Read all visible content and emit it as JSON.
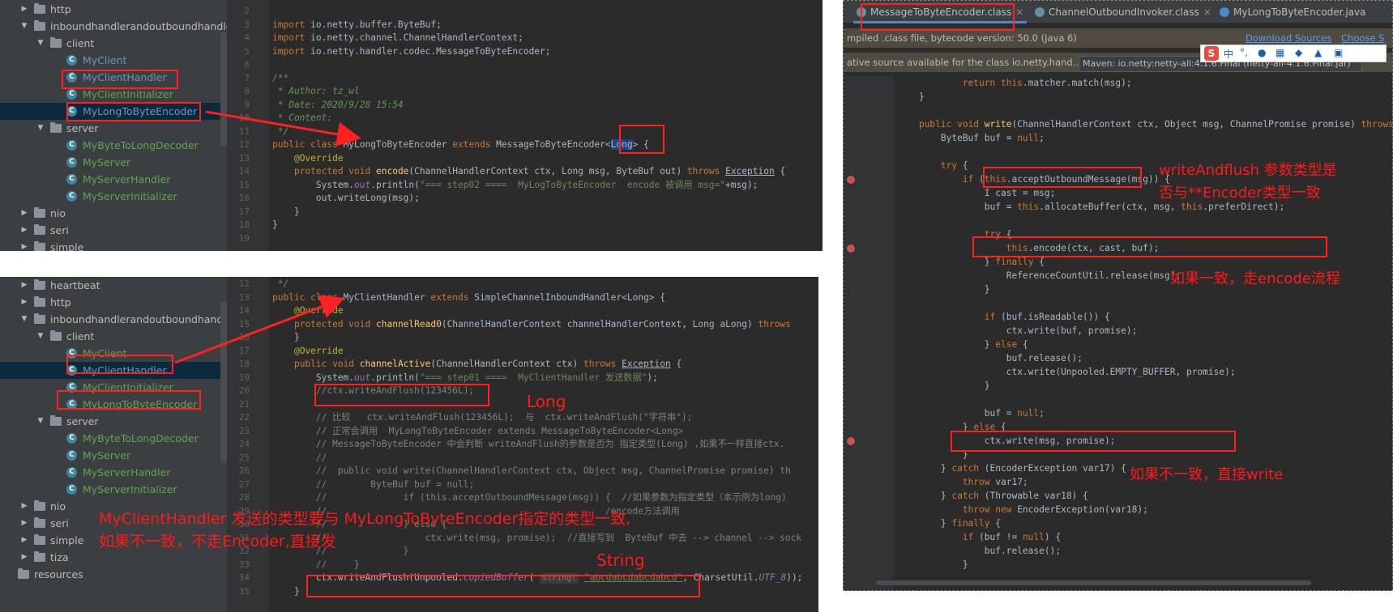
{
  "top_left": {
    "tree": [
      {
        "label": "http",
        "indent": 0,
        "type": "folder",
        "arrow": "▶"
      },
      {
        "label": "inboundhandlerandoutboundhandler",
        "indent": 0,
        "type": "folder",
        "arrow": "▼"
      },
      {
        "label": "client",
        "indent": 1,
        "type": "folder",
        "arrow": "▼"
      },
      {
        "label": "MyClient",
        "indent": 2,
        "type": "class",
        "color": "b"
      },
      {
        "label": "MyClientHandler",
        "indent": 2,
        "type": "class",
        "color": "b"
      },
      {
        "label": "MyClientInitializer",
        "indent": 2,
        "type": "class",
        "color": "g"
      },
      {
        "label": "MyLongToByteEncoder",
        "indent": 2,
        "type": "class",
        "color": "b",
        "selected": true
      },
      {
        "label": "server",
        "indent": 1,
        "type": "folder",
        "arrow": "▼"
      },
      {
        "label": "MyByteToLongDecoder",
        "indent": 2,
        "type": "class",
        "color": "g"
      },
      {
        "label": "MyServer",
        "indent": 2,
        "type": "class",
        "color": "g"
      },
      {
        "label": "MyServerHandler",
        "indent": 2,
        "type": "class",
        "color": "g"
      },
      {
        "label": "MyServerInitializer",
        "indent": 2,
        "type": "class",
        "color": "g"
      },
      {
        "label": "nio",
        "indent": 0,
        "type": "folder",
        "arrow": "▶"
      },
      {
        "label": "seri",
        "indent": 0,
        "type": "folder",
        "arrow": "▶"
      },
      {
        "label": "simple",
        "indent": 0,
        "type": "folder",
        "arrow": "▶"
      }
    ],
    "line_numbers": [
      "2",
      "3",
      "4",
      "5",
      "6",
      "7",
      "8",
      "9",
      "10",
      "11",
      "12",
      "13",
      "14",
      "15",
      "16",
      "17",
      "18",
      "19"
    ],
    "code": [
      "",
      "<span class='kw'>import</span> io.netty.buffer.ByteBuf;",
      "<span class='kw'>import</span> io.netty.channel.ChannelHandlerContext;",
      "<span class='kw'>import</span> io.netty.handler.codec.MessageToByteEncoder;",
      "",
      "<span class='jd'>/**</span>",
      "<span class='jd'> * Author: tz_wl</span>",
      "<span class='jd'> * Date: 2020/9/28 15:54</span>",
      "<span class='jd'> * Content:</span>",
      "<span class='jd'> */</span>",
      "<span class='kw'>public class</span> MyLongToByteEncoder <span class='kw'>extends</span> MessageToByteEncoder&lt;<span style='background:#214283'>Long</span>&gt; {",
      "    <span class='an'>@Override</span>",
      "    <span class='kw'>protected void</span> <span class='fn'>encode</span>(ChannelHandlerContext ctx, Long msg, ByteBuf out) <span class='kw'>throws</span> <u>Exception</u> {",
      "        System.<span class='pu'>out</span>.println(<span class='st'>\"=== step02 ====  MyLogToByteEncoder  encode 被调用 msg=\"</span>+msg);",
      "        out.writeLong(msg);",
      "    }",
      "}",
      ""
    ]
  },
  "bottom_left": {
    "tree": [
      {
        "label": "heartbeat",
        "indent": 0,
        "type": "folder",
        "arrow": "▶"
      },
      {
        "label": "http",
        "indent": 0,
        "type": "folder",
        "arrow": "▶"
      },
      {
        "label": "inboundhandlerandoutboundhandler",
        "indent": 0,
        "type": "folder",
        "arrow": "▼"
      },
      {
        "label": "client",
        "indent": 1,
        "type": "folder",
        "arrow": "▼"
      },
      {
        "label": "MyClient",
        "indent": 2,
        "type": "class",
        "color": "g"
      },
      {
        "label": "MyClientHandler",
        "indent": 2,
        "type": "class",
        "color": "b",
        "selected": true
      },
      {
        "label": "MyClientInitializer",
        "indent": 2,
        "type": "class",
        "color": "g"
      },
      {
        "label": "MyLongToByteEncoder",
        "indent": 2,
        "type": "class",
        "color": "g"
      },
      {
        "label": "server",
        "indent": 1,
        "type": "folder",
        "arrow": "▼"
      },
      {
        "label": "MyByteToLongDecoder",
        "indent": 2,
        "type": "class",
        "color": "g"
      },
      {
        "label": "MyServer",
        "indent": 2,
        "type": "class",
        "color": "g"
      },
      {
        "label": "MyServerHandler",
        "indent": 2,
        "type": "class",
        "color": "g"
      },
      {
        "label": "MyServerInitializer",
        "indent": 2,
        "type": "class",
        "color": "g"
      },
      {
        "label": "nio",
        "indent": 0,
        "type": "folder",
        "arrow": "▶"
      },
      {
        "label": "seri",
        "indent": 0,
        "type": "folder",
        "arrow": "▶"
      },
      {
        "label": "simple",
        "indent": 0,
        "type": "folder",
        "arrow": "▶"
      },
      {
        "label": "tiza",
        "indent": 0,
        "type": "folder",
        "arrow": "▶"
      },
      {
        "label": "resources",
        "indent": -1,
        "type": "folder",
        "arrow": ""
      }
    ],
    "line_numbers": [
      "12",
      "13",
      "14",
      "15",
      "16",
      "17",
      "18",
      "19",
      "20",
      "21",
      "22",
      "23",
      "24",
      "25",
      "26",
      "27",
      "28",
      "29",
      "30",
      "31",
      "32",
      "33",
      "34",
      "35"
    ],
    "code": [
      " <span class='jd'>*/</span>",
      "<span class='kw'>public class</span> MyClientHandler <span class='kw'>extends</span> SimpleChannelInboundHandler&lt;Long&gt; {",
      "    <span class='an'>@Override</span>",
      "    <span class='kw'>protected void</span> <span class='fn'>channelRead0</span>(ChannelHandlerContext channelHandlerContext, Long aLong) <span class='kw'>throws</span>",
      "    }",
      "    <span class='an'>@Override</span>",
      "    <span class='kw'>public void</span> <span class='fn'>channelActive</span>(ChannelHandlerContext ctx) <span class='kw'>throws</span> <u>Exception</u> {",
      "        System.<span class='pu'>out</span>.println(<span class='st'>\"=== step01 ====  MyClientHandler 发送数据\"</span>);",
      "        <span class='cm'>//ctx.writeAndFlush(123456L);</span>",
      "",
      "        <span class='cm'>// 比较   ctx.writeAndFlush(123456L);  与  ctx.writeAndFlush(\"字符串\");</span>",
      "        <span class='cm'>// 正常会调用  MyLongToByteEncoder extends MessageToByteEncoder&lt;Long&gt;</span>",
      "        <span class='cm'>// MessageToByteEncoder 中会判断 writeAndFlush的参数是否为 指定类型(Long) ,如果不一样直接ctx.</span>",
      "        <span class='cm'>//</span>",
      "        <span class='cm'>//  public void write(ChannelHandlerContext ctx, Object msg, ChannelPromise promise) th</span>",
      "        <span class='cm'>//        ByteBuf buf = null;</span>",
      "        <span class='cm'>//              if (this.acceptOutboundMessage(msg)) {  //如果参数为指定类型（本示例为long)</span>",
      "        <span class='cm'>//                                                   /encode方法调用</span>",
      "        <span class='cm'>//              } else {</span>",
      "        <span class='cm'>//                  ctx.write(msg, promise);  //直接写到  ByteBuf 中去 --&gt; channel --&gt; sock</span>",
      "        <span class='cm'>//              }</span>",
      "        <span class='cm'>//     }</span>",
      "        ctx.writeAndFlush(Unpooled.<span class='pu'>copiedBuffer</span>( <span class='hintpill'>string:</span> <span class='st'><u>\"abcdabcdabcdabcd\"</u></span>, CharsetUtil.<span class='pu'>UTF_8</span>));",
      "    }"
    ]
  },
  "right": {
    "tabs": [
      {
        "label": "MessageToByteEncoder.class",
        "active": true
      },
      {
        "label": "ChannelOutboundInvoker.class",
        "active": false
      },
      {
        "label": "MyLongToByteEncoder.java",
        "active": false
      }
    ],
    "tab_close": "×",
    "info1": "mpiled .class file, bytecode version: 50.0 (Java 6)",
    "download_link": "Download Sources",
    "choose_link": "Choose S",
    "info2": "ative source available for the class io.netty.hand...",
    "tooltip": "Maven: io.netty:netty-all:4.1.6.Final (netty-all-4.1.6.Final.jar)",
    "ime_label": "中",
    "code": [
      "            <span class='kw'>return this</span>.matcher.match(msg);",
      "    }",
      "",
      "    <span class='kw'>public void</span> <span class='fn'>write</span>(ChannelHandlerContext ctx, Object msg, ChannelPromise promise) <span class='kw'>throws</span>",
      "        ByteBuf buf = <span class='kw'>null</span>;",
      "",
      "        <span class='kw'>try</span> {",
      "            <span class='kw'>if</span> (<span class='kw'>this</span>.acceptOutboundMessage(msg)) {",
      "                I cast = msg;",
      "                buf = <span class='kw'>this</span>.allocateBuffer(ctx, msg, <span class='kw'>this</span>.preferDirect);",
      "",
      "                <span class='kw'>try</span> {",
      "                    <span class='kw'>this</span>.encode(ctx, cast, buf);",
      "                } <span class='kw'>finally</span> {",
      "                    ReferenceCountUtil.release(msg);",
      "                }",
      "",
      "                <span class='kw'>if</span> (buf.isReadable()) {",
      "                    ctx.write(buf, promise);",
      "                } <span class='kw'>else</span> {",
      "                    buf.release();",
      "                    ctx.write(Unpooled.EMPTY_BUFFER, promise);",
      "                }",
      "",
      "                buf = <span class='kw'>null</span>;",
      "            } <span class='kw'>else</span> {",
      "                ctx.write(msg, promise);",
      "            }",
      "        } <span class='kw'>catch</span> (EncoderException var17) {",
      "            <span class='kw'>throw</span> var17;",
      "        } <span class='kw'>catch</span> (Throwable var18) {",
      "            <span class='kw'>throw new</span> EncoderException(var18);",
      "        } <span class='kw'>finally</span> {",
      "            <span class='kw'>if</span> (buf != <span class='kw'>null</span>) {",
      "                buf.release();",
      "            }"
    ]
  },
  "annotations": {
    "long_label": "Long",
    "string_label": "String",
    "bottom_note_line1": "MyClientHandler 发送的类型要与 MyLongToByteEncoder指定的类型一致,",
    "bottom_note_line2": "如果不一致，不走Encoder,直接发",
    "right_note1_line1": "writeAndflush 参数类型是",
    "right_note1_line2": "否与**Encoder类型一致",
    "right_note2": "如果一致，走encode流程",
    "right_note3": "如果不一致，直接write"
  },
  "colors": {
    "annotation_red": "#ff1a1a",
    "editor_bg": "#2b2b2b",
    "tree_bg": "#3c3f41",
    "selection": "#0d293e"
  }
}
